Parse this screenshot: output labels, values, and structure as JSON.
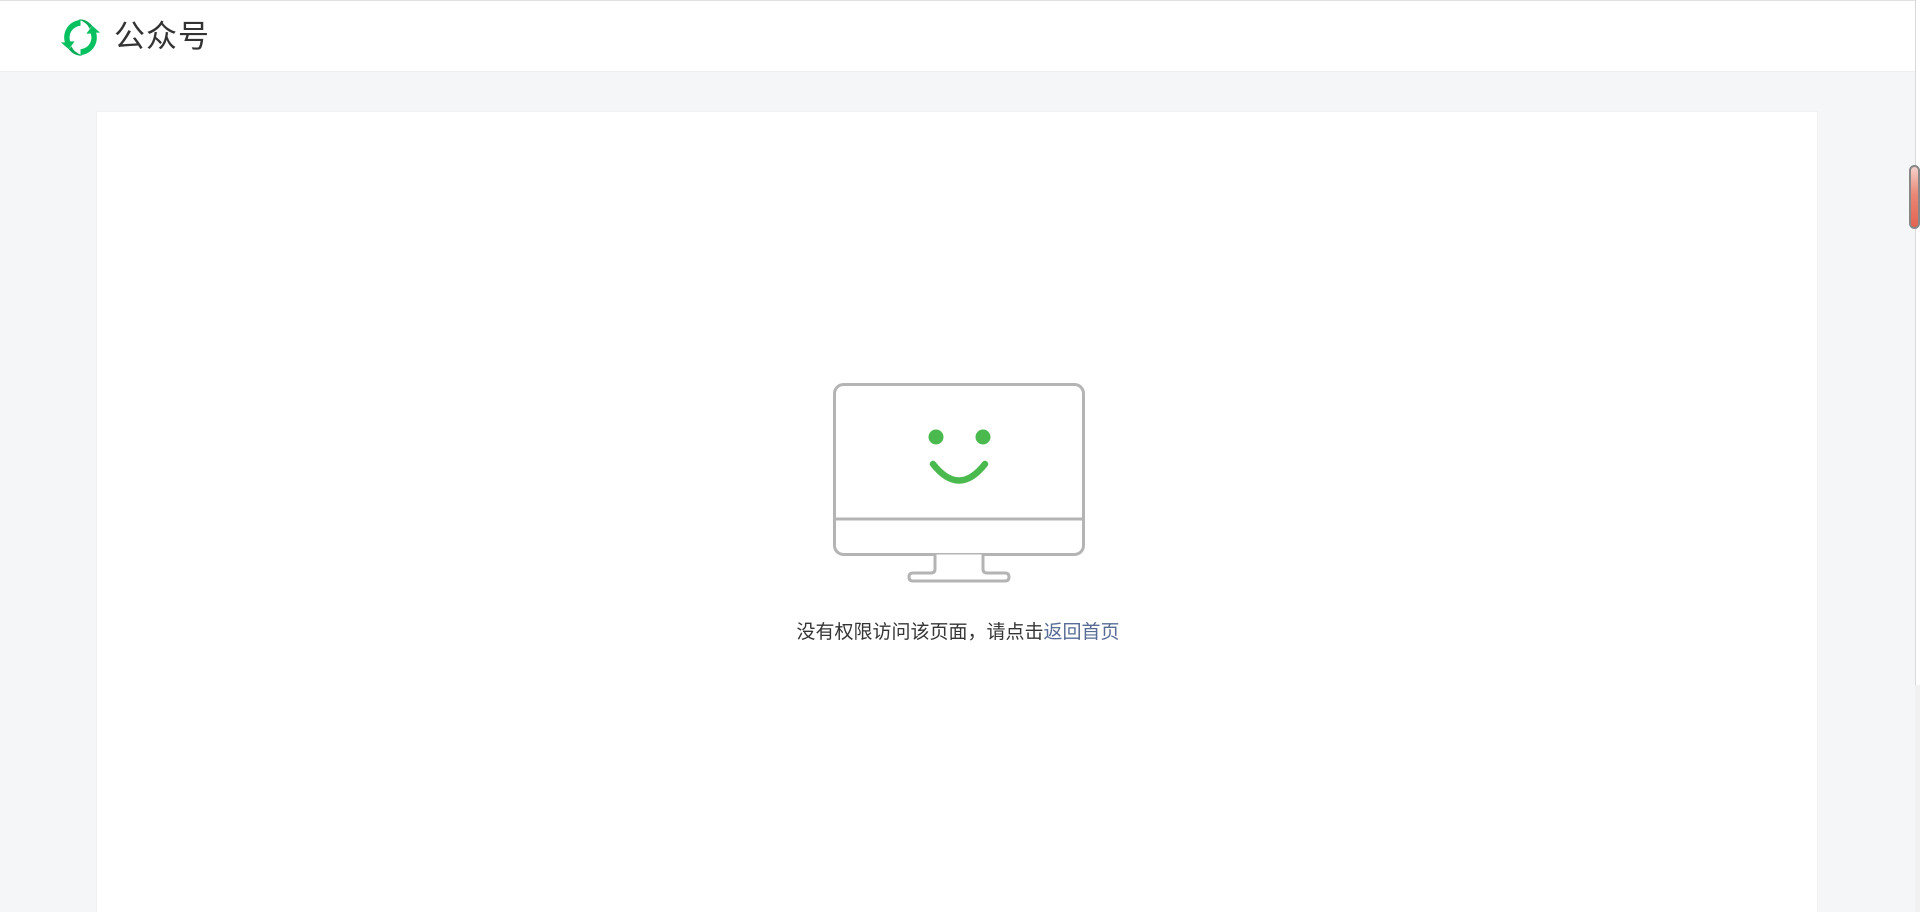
{
  "header": {
    "brand_name": "公众号",
    "brand_icon": "wechat-official-account-logo",
    "brand_color": "#07c160"
  },
  "error": {
    "illustration_icon": "smiling-monitor-icon",
    "message_prefix": "没有权限访问该页面，请点击",
    "home_link_label": "返回首页",
    "accent_color": "#4aba4f",
    "link_color": "#576b95"
  }
}
